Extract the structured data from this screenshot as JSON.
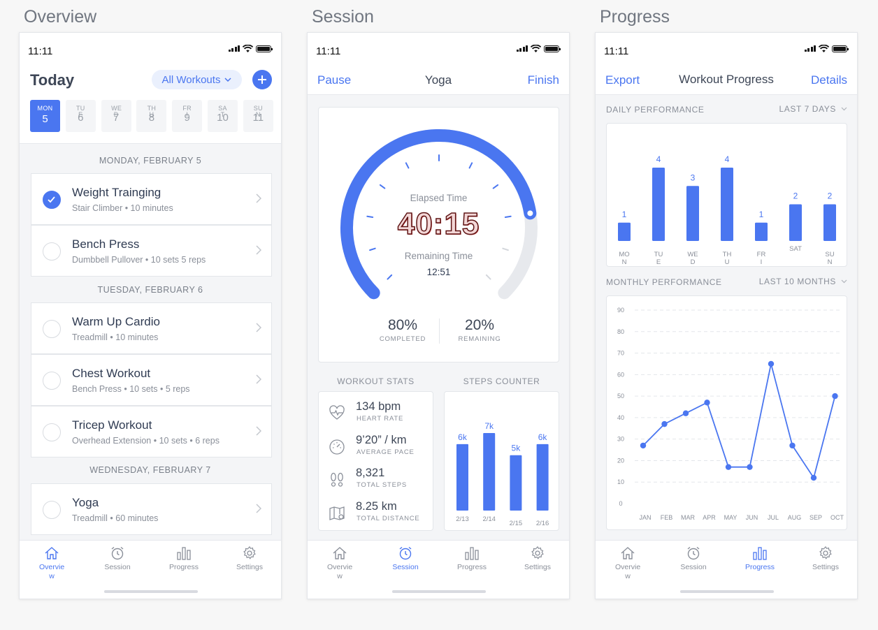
{
  "screens": {
    "overview_title": "Overview",
    "session_title": "Session",
    "progress_title": "Progress"
  },
  "status_time": "11:11",
  "overview": {
    "heading": "Today",
    "filter_label": "All Workouts",
    "days": [
      {
        "name": "MON",
        "num": "5",
        "active": true
      },
      {
        "name": "TU E",
        "num": "6"
      },
      {
        "name": "WE D",
        "num": "7"
      },
      {
        "name": "TH U",
        "num": "8"
      },
      {
        "name": "FR I",
        "num": "9"
      },
      {
        "name": "SA T",
        "num": "10"
      },
      {
        "name": "SU N",
        "num": "11"
      }
    ],
    "sections": [
      {
        "date": "MONDAY, FEBRUARY 5"
      },
      {
        "date": "TUESDAY, FEBRUARY 6"
      },
      {
        "date": "WEDNESDAY, FEBRUARY 7"
      }
    ],
    "workouts": [
      {
        "title": "Weight Trainging",
        "sub": "Stair Climber • 10 minutes",
        "done": true
      },
      {
        "title": "Bench Press",
        "sub": "Dumbbell Pullover •  10 sets 5 reps",
        "done": false
      },
      {
        "title": "Warm Up Cardio",
        "sub": "Treadmill • 10 minutes",
        "done": false
      },
      {
        "title": "Chest Workout",
        "sub": "Bench Press • 10 sets • 5 reps",
        "done": false
      },
      {
        "title": "Tricep Workout",
        "sub": "Overhead Extension • 10 sets • 6 reps",
        "done": false
      },
      {
        "title": "Yoga",
        "sub": "Treadmill • 60 minutes",
        "done": false
      }
    ]
  },
  "session": {
    "pause": "Pause",
    "title": "Yoga",
    "finish": "Finish",
    "elapsed_label": "Elapsed Time",
    "elapsed": "40:15",
    "remaining_label": "Remaining Time",
    "remaining": "12:51",
    "progress": 0.8,
    "completed_pct": "80%",
    "completed_label": "COMPLETED",
    "remaining_pct": "20%",
    "remaining_pct_label": "REMAINING",
    "stats_label": "WORKOUT STATS",
    "steps_label": "STEPS COUNTER",
    "stats": [
      {
        "icon": "heart-rate-icon",
        "value": "134 bpm",
        "label": "HEART RATE"
      },
      {
        "icon": "gauge-icon",
        "value": "9’20” / km",
        "label": "AVERAGE PACE"
      },
      {
        "icon": "footsteps-icon",
        "value": "8,321",
        "label": "TOTAL STEPS"
      },
      {
        "icon": "map-icon",
        "value": "8.25 km",
        "label": "TOTAL DISTANCE"
      }
    ],
    "steps": [
      {
        "date": "2/13",
        "label": "6k",
        "value": 6
      },
      {
        "date": "2/14",
        "label": "7k",
        "value": 7
      },
      {
        "date": "2/15",
        "label": "5k",
        "value": 5
      },
      {
        "date": "2/16",
        "label": "6k",
        "value": 6
      }
    ]
  },
  "progress": {
    "export": "Export",
    "title": "Workout Progress",
    "details": "Details",
    "daily_label": "DAILY PERFORMANCE",
    "daily_range": "LAST 7 DAYS",
    "monthly_label": "MONTHLY PERFORMANCE",
    "monthly_range": "LAST 10 MONTHS"
  },
  "tabs": [
    "Overvie w",
    "Session",
    "Progress",
    "Settings"
  ],
  "chart_data": [
    {
      "type": "bar",
      "categories": [
        "MO N",
        "TU E",
        "WE D",
        "TH U",
        "FR I",
        "SAT",
        "SU N"
      ],
      "values": [
        1,
        4,
        3,
        4,
        1,
        2,
        2
      ],
      "ylim": [
        0,
        4
      ]
    },
    {
      "type": "line",
      "categories": [
        "JAN",
        "FEB",
        "MAR",
        "APR",
        "MAY",
        "JUN",
        "JUL",
        "AUG",
        "SEP",
        "OCT"
      ],
      "values": [
        27,
        37,
        42,
        47,
        17,
        17,
        65,
        27,
        12,
        50
      ],
      "yticks": [
        0,
        10,
        20,
        30,
        40,
        50,
        60,
        70,
        80,
        90
      ],
      "ylim": [
        0,
        90
      ],
      "grid": true
    }
  ]
}
